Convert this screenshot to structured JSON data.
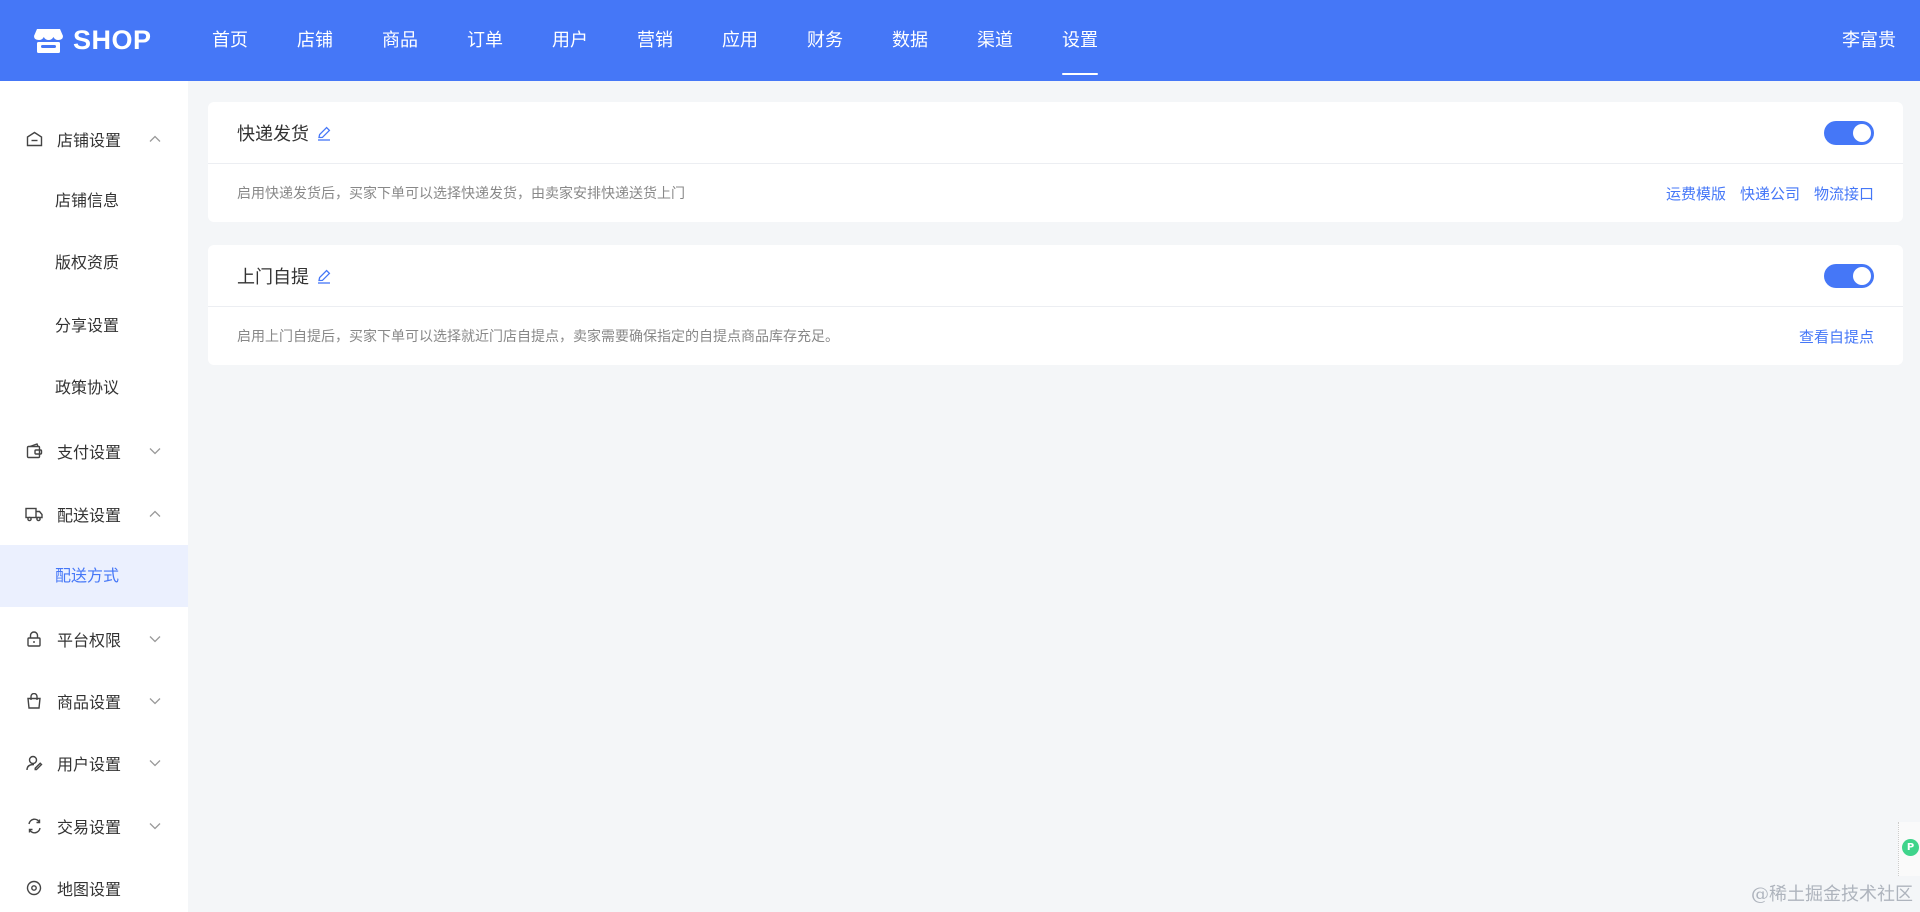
{
  "header": {
    "logo_text": "SHOP",
    "nav": [
      "首页",
      "店铺",
      "商品",
      "订单",
      "用户",
      "营销",
      "应用",
      "财务",
      "数据",
      "渠道",
      "设置"
    ],
    "active_nav": "设置",
    "user_name": "李富贵"
  },
  "sidebar": {
    "store_settings": {
      "label": "店铺设置",
      "icon": "home-icon",
      "expanded": true
    },
    "store_info": "店铺信息",
    "copyright": "版权资质",
    "share_settings": "分享设置",
    "policy": "政策协议",
    "payment_settings": {
      "label": "支付设置",
      "icon": "wallet-icon",
      "expanded": false
    },
    "delivery_settings": {
      "label": "配送设置",
      "icon": "truck-icon",
      "expanded": true
    },
    "delivery_method": "配送方式",
    "platform_permissions": {
      "label": "平台权限",
      "icon": "lock-icon",
      "expanded": false
    },
    "product_settings": {
      "label": "商品设置",
      "icon": "bag-icon",
      "expanded": false
    },
    "user_settings": {
      "label": "用户设置",
      "icon": "user-edit-icon",
      "expanded": false
    },
    "trade_settings": {
      "label": "交易设置",
      "icon": "exchange-icon",
      "expanded": false
    },
    "map_settings": {
      "label": "地图设置",
      "icon": "map-pin-icon"
    }
  },
  "cards": {
    "express": {
      "title": "快递发货",
      "enabled": true,
      "description": "启用快递发货后，买家下单可以选择快递发货，由卖家安排快递送货上门",
      "links": [
        "运费模版",
        "快递公司",
        "物流接口"
      ]
    },
    "pickup": {
      "title": "上门自提",
      "enabled": true,
      "description": "启用上门自提后，买家下单可以选择就近门店自提点，卖家需要确保指定的自提点商品库存充足。",
      "links": [
        "查看自提点"
      ]
    }
  },
  "watermark": "@稀土掘金技术社区",
  "colors": {
    "primary": "#4577f7",
    "background": "#f4f6f8",
    "active_bg": "#ebf0fe"
  }
}
